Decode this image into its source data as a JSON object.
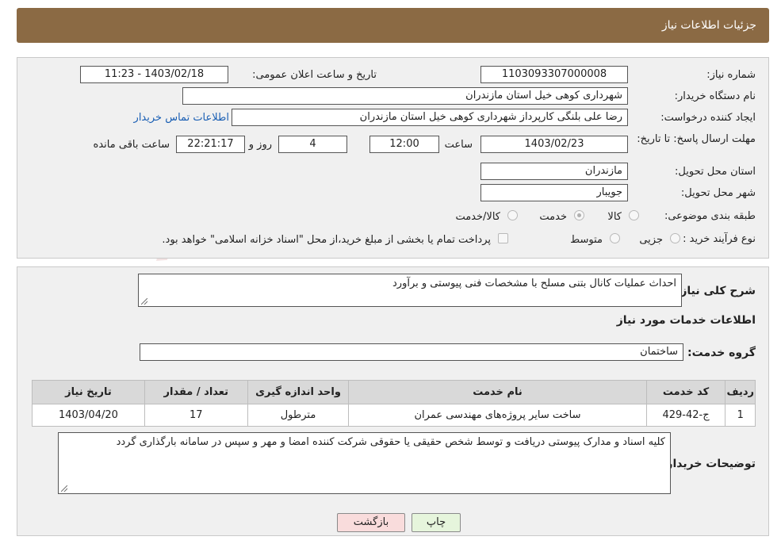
{
  "header": {
    "title": "جزئیات اطلاعات نیاز"
  },
  "details": {
    "need_number_label": "شماره نیاز:",
    "need_number": "1103093307000008",
    "announce_label": "تاریخ و ساعت اعلان عمومی:",
    "announce_value": "1403/02/18 - 11:23",
    "buyer_org_label": "نام دستگاه خریدار:",
    "buyer_org": "شهرداری کوهی خیل استان مازندران",
    "creator_label": "ایجاد کننده درخواست:",
    "creator": "رضا علی  بلنگی  کارپرداز شهرداری کوهی خیل استان مازندران",
    "contact_link": "اطلاعات تماس خریدار",
    "deadline_label": "مهلت ارسال پاسخ: تا تاریخ:",
    "deadline_date": "1403/02/23",
    "time_label": "ساعت",
    "deadline_time": "12:00",
    "days_value": "4",
    "days_label": "روز و",
    "remaining_time": "22:21:17",
    "remaining_label": "ساعت باقی مانده",
    "province_label": "استان محل تحویل:",
    "province": "مازندران",
    "city_label": "شهر محل تحویل:",
    "city": "جویبار",
    "category_label": "طبقه بندی موضوعی:",
    "category_options": [
      {
        "label": "کالا",
        "checked": false
      },
      {
        "label": "خدمت",
        "checked": true
      },
      {
        "label": "کالا/خدمت",
        "checked": false
      }
    ],
    "purchase_type_label": "نوع فرآیند خرید :",
    "purchase_options": [
      {
        "label": "جزیی",
        "checked": false
      },
      {
        "label": "متوسط",
        "checked": false
      }
    ],
    "payment_note": "پرداخت تمام یا بخشی از مبلغ خرید،از محل \"اسناد خزانه اسلامی\" خواهد بود."
  },
  "need": {
    "summary_label": "شرح کلی نیاز:",
    "summary": "احداث عملیات کانال بتنی مسلح با مشخصات فنی پیوستی و برآورد",
    "services_title": "اطلاعات خدمات مورد نیاز",
    "service_group_label": "گروه خدمت:",
    "service_group": "ساختمان",
    "table": {
      "headers": [
        "ردیف",
        "کد خدمت",
        "نام خدمت",
        "واحد اندازه گیری",
        "تعداد / مقدار",
        "تاریخ نیاز"
      ],
      "rows": [
        [
          "1",
          "ج-42-429",
          "ساخت سایر پروژه‌های مهندسی عمران",
          "مترطول",
          "17",
          "1403/04/20"
        ]
      ]
    },
    "buyer_notes_label": "توضیحات خریدار:",
    "buyer_notes": "کلیه اسناد و مدارک پیوستی دریافت و توسط شخص حقیقی یا حقوقی شرکت کننده امضا و مهر و سپس در سامانه بارگذاری گردد"
  },
  "buttons": {
    "print": "چاپ",
    "back": "بازگشت"
  },
  "watermark": "AriaTender.neT"
}
